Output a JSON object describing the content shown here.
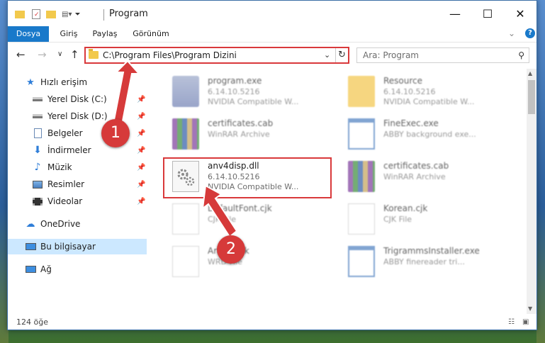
{
  "window": {
    "title": "Program",
    "controls": {
      "minimize": "—",
      "maximize": "☐",
      "close": "✕"
    }
  },
  "ribbon": {
    "tabs": [
      "Dosya",
      "Giriş",
      "Paylaş",
      "Görünüm"
    ],
    "help": "?"
  },
  "navigation": {
    "back": "←",
    "forward": "→",
    "recent": "∨",
    "up": "↑",
    "address": "C:\\Program Files\\Program Dizini",
    "refresh": "↻",
    "search_placeholder": "Ara: Program"
  },
  "sidebar": {
    "items": [
      {
        "label": "Hızlı erişim",
        "icon": "star-icon"
      },
      {
        "label": "Yerel Disk (C:)",
        "icon": "drive-icon",
        "pinned": true
      },
      {
        "label": "Yerel Disk (D:)",
        "icon": "drive-icon",
        "pinned": true
      },
      {
        "label": "Belgeler",
        "icon": "documents-icon",
        "pinned": true
      },
      {
        "label": "İndirmeler",
        "icon": "download-icon",
        "pinned": true
      },
      {
        "label": "Müzik",
        "icon": "music-icon",
        "pinned": true
      },
      {
        "label": "Resimler",
        "icon": "pictures-icon",
        "pinned": true
      },
      {
        "label": "Videolar",
        "icon": "videos-icon",
        "pinned": true
      },
      {
        "label": "OneDrive",
        "icon": "cloud-icon"
      },
      {
        "label": "Bu bilgisayar",
        "icon": "computer-icon",
        "selected": true
      },
      {
        "label": "Ağ",
        "icon": "network-icon"
      }
    ]
  },
  "files": [
    {
      "name": "program.exe",
      "line1": "6.14.10.5216",
      "line2": "NVIDIA Compatible W...",
      "icon": "exe-icon"
    },
    {
      "name": "Resource",
      "line1": "6.14.10.5216",
      "line2": "NVIDIA Compatible W...",
      "icon": "folder-icon"
    },
    {
      "name": "certificates.cab",
      "line1": "WinRAR Archive",
      "line2": "",
      "icon": "winrar-icon"
    },
    {
      "name": "FineExec.exe",
      "line1": "ABBY background exe...",
      "line2": "",
      "icon": "app-icon"
    },
    {
      "name": "anv4disp.dll",
      "line1": "6.14.10.5216",
      "line2": "NVIDIA Compatible W...",
      "icon": "dll-icon"
    },
    {
      "name": "certificates.cab",
      "line1": "WinRAR Archive",
      "line2": "",
      "icon": "winrar-icon"
    },
    {
      "name": "DefaultFont.cjk",
      "line1": "CJK File",
      "line2": "",
      "icon": "document-icon"
    },
    {
      "name": "Korean.cjk",
      "line1": "CJK File",
      "line2": "",
      "icon": "document-icon"
    },
    {
      "name": "Arabic.cjk",
      "line1": "WRD File",
      "line2": "",
      "icon": "document-icon"
    },
    {
      "name": "TrigrammsInstaller.exe",
      "line1": "ABBY finereader tri...",
      "line2": "",
      "icon": "app-icon"
    }
  ],
  "annotations": {
    "step1": "1",
    "step2": "2",
    "highlight_color": "#d9393b"
  },
  "status": {
    "count": "124 öğe"
  },
  "colors": {
    "accent": "#1979ca",
    "selection": "#cce8ff",
    "badge": "#d63a3a"
  }
}
